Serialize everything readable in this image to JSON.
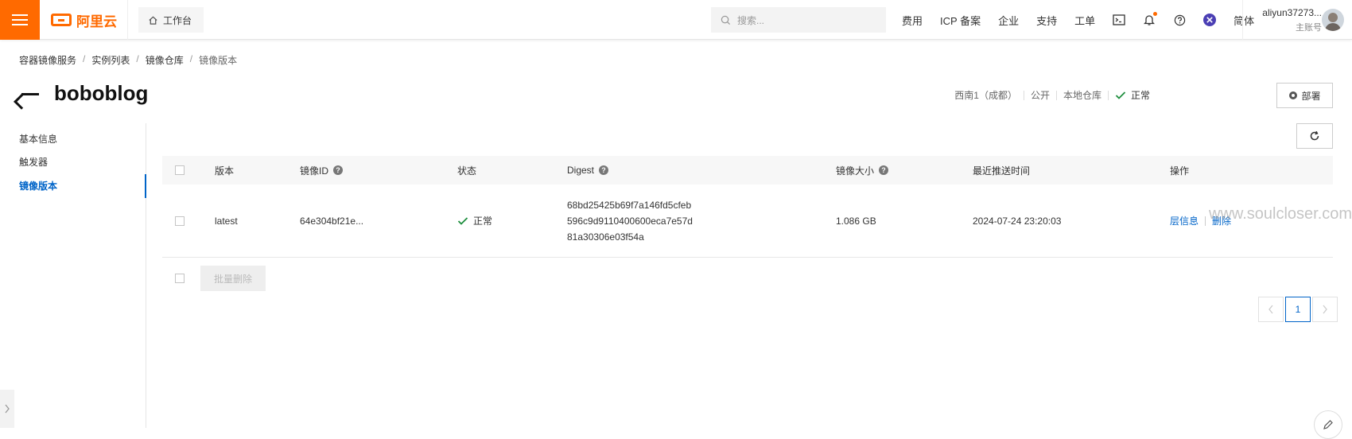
{
  "topbar": {
    "logo_text": "阿里云",
    "workbench_label": "工作台",
    "search_placeholder": "搜索...",
    "nav": [
      "费用",
      "ICP 备案",
      "企业",
      "支持",
      "工单"
    ],
    "lang": "简体",
    "user_name": "aliyun37273...",
    "user_role": "主账号",
    "accent_color": "#ff6a00"
  },
  "breadcrumb": [
    "容器镜像服务",
    "实例列表",
    "镜像仓库",
    "镜像版本"
  ],
  "page": {
    "title": "boboblog",
    "region": "西南1（成都）",
    "visibility": "公开",
    "repo_type": "本地仓库",
    "status": "正常",
    "deploy_label": "部署"
  },
  "leftnav": {
    "items": [
      "基本信息",
      "触发器",
      "镜像版本"
    ],
    "active_index": 2
  },
  "table": {
    "headers": {
      "version": "版本",
      "image_id": "镜像ID",
      "status": "状态",
      "digest": "Digest",
      "size": "镜像大小",
      "pushed": "最近推送时间",
      "ops": "操作"
    },
    "rows": [
      {
        "version": "latest",
        "image_id": "64e304bf21e...",
        "status": "正常",
        "digest_lines": [
          "68bd25425b69f7a146fd5cfeb",
          "596c9d9110400600eca7e57d",
          "81a30306e03f54a"
        ],
        "size": "1.086 GB",
        "pushed": "2024-07-24 23:20:03",
        "op_layers": "层信息",
        "op_delete": "删除"
      }
    ]
  },
  "batch_delete_label": "批量删除",
  "pagination": {
    "current": "1"
  },
  "watermark": "www.soulcloser.com"
}
